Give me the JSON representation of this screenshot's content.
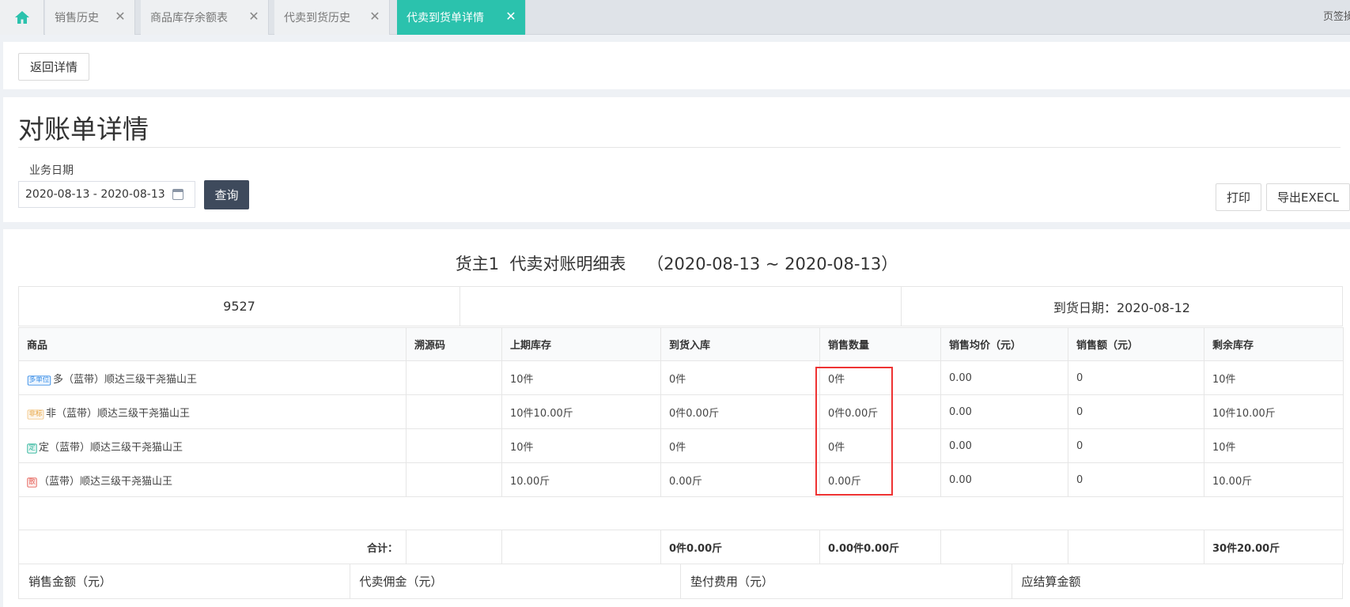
{
  "tabs": [
    {
      "label": "销售历史",
      "close": "✕"
    },
    {
      "label": "商品库存余额表",
      "close": "✕"
    },
    {
      "label": "代卖到货历史",
      "close": "✕"
    },
    {
      "label": "代卖到货单详情",
      "close": "✕"
    }
  ],
  "tabbar_right": "页签操作",
  "back_button": "返回详情",
  "page_title": "对账单详情",
  "filter": {
    "date_label": "业务日期",
    "date_value": "2020-08-13 - 2020-08-13",
    "query_button": "查询"
  },
  "actions": {
    "print": "打印",
    "export": "导出EXECL"
  },
  "report": {
    "title": "货主1  代卖对账明细表    （2020-08-13 ~ 2020-08-13）",
    "info": [
      "9527",
      "",
      "到货日期：2020-08-12"
    ]
  },
  "table": {
    "headers": [
      "商品",
      "溯源码",
      "上期库存",
      "到货入库",
      "销售数量",
      "销售均价（元）",
      "销售额（元）",
      "剩余库存"
    ],
    "rows": [
      {
        "tag": "多单位",
        "name": "多（蓝带）顺达三级干尧猫山王",
        "trace": "",
        "prev": "10件",
        "in": "0件",
        "qty": "0件",
        "price": "0.00",
        "amount": "0",
        "remain": "10件"
      },
      {
        "tag": "非标",
        "name": "非（蓝带）顺达三级干尧猫山王",
        "trace": "",
        "prev": "10件10.00斤",
        "in": "0件0.00斤",
        "qty": "0件0.00斤",
        "price": "0.00",
        "amount": "0",
        "remain": "10件10.00斤"
      },
      {
        "tag": "定",
        "name": "定（蓝带）顺达三级干尧猫山王",
        "trace": "",
        "prev": "10件",
        "in": "0件",
        "qty": "0件",
        "price": "0.00",
        "amount": "0",
        "remain": "10件"
      },
      {
        "tag": "散",
        "name": "（蓝带）顺达三级干尧猫山王",
        "trace": "",
        "prev": "10.00斤",
        "in": "0.00斤",
        "qty": "0.00斤",
        "price": "0.00",
        "amount": "0",
        "remain": "10.00斤"
      }
    ],
    "total": {
      "label": "合计：",
      "in": "0件0.00斤",
      "qty": "0.00件0.00斤",
      "remain": "30件20.00斤"
    }
  },
  "summary_headers": [
    "销售金额（元）",
    "代卖佣金（元）",
    "垫付费用（元）",
    "应结算金额"
  ]
}
